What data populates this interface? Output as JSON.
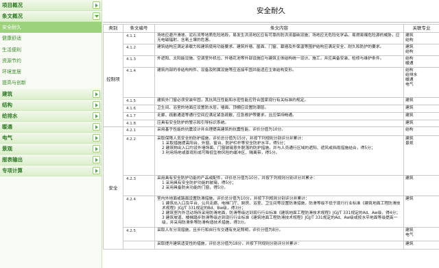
{
  "sidebar": {
    "groups_top": [
      {
        "label": "项目概况",
        "open": false
      },
      {
        "label": "条文概况",
        "open": true
      }
    ],
    "items": [
      "安全耐久",
      "健康舒适",
      "生活便利",
      "资源节约",
      "环境宜居",
      "提高与创新"
    ],
    "active_index": 0,
    "groups_bottom": [
      "建筑",
      "结构",
      "给排水",
      "暖通",
      "电气",
      "景观",
      "报表输出",
      "专项计算"
    ]
  },
  "page_title": "安全耐久",
  "table": {
    "headers": {
      "category": "类别",
      "code": "条文编号",
      "content": "条文内容",
      "prof": "关联专业"
    },
    "cat_control": "控制项",
    "cat_score": "安全",
    "control_rows": [
      {
        "code": "4.1.1",
        "content": "场地应避开滑坡、泥石流等地质危险地段，易发生洪涝地区应有可靠的防洪涝基础设施；场地应无危险化学品、易燃易爆危险源的威胁，应无电磁辐射、含氡土壤的危害。",
        "prof": [
          "建筑",
          "结构"
        ]
      },
      {
        "code": "4.1.2",
        "content": "建筑结构应满足承载力和建筑使用功能要求。建筑外墙、屋面、门窗、幕墙及外保温等围护结构应满足安全、耐久和防护的要求。",
        "prof": [
          "建筑",
          "结构"
        ]
      },
      {
        "code": "4.1.3",
        "content": "外遮阳、太阳能设施、空调室外机位、外墙花池等外部设施应与建筑主体结构统一设计、施工，并应具备安装、检修与维护条件。",
        "prof": [
          "结构",
          "暖通"
        ]
      },
      {
        "code": "4.1.4",
        "content": "建筑内部的非结构构件、设备及附属设施等应连接牢固并能适应主体结构变形。",
        "prof": [
          "结构",
          "给排水",
          "暖通",
          "电气"
        ]
      },
      {
        "code": "4.1.5",
        "content": "建筑外门窗必须安装牢固，其抗风压性能和水密性能应符合国家现行有关标准的规定。",
        "prof": [
          "建筑"
        ]
      },
      {
        "code": "4.1.6",
        "content": "卫生间、浴室的地面应设置防水层，墙面、顶棚应设置防潮层。",
        "prof": [
          "建筑"
        ]
      },
      {
        "code": "4.1.7",
        "content": "走廊、疏散通道等通行空间应满足紧急疏散、应急救护等要求，且应保持畅通。",
        "prof": [
          "建筑"
        ]
      },
      {
        "code": "4.1.8",
        "content": "应具有安全防护的警示和引导标识系统。",
        "prof": [
          "建筑"
        ]
      }
    ],
    "score_rows": [
      {
        "code": "4.2.1",
        "lines": [
          "采用基于性能的抗震设计并合理提高建筑的抗震性能。评价分值为10分。"
        ],
        "prof": [
          "结构"
        ]
      },
      {
        "code": "4.2.2",
        "lines": [
          "采取保障人员安全的防护措施，评价总分值为15分，并按下列规则分别评分并累计：",
          "1 采取措施提高阳台、外窗、窗台、防护栏杆等安全防护水平，得5分；",
          "2 建筑物出入口均设外墙饰面、门窗玻璃意外脱落的防护措施，并与人员通行区域的遮阳、遮风或挡雨措施结合，得5分；",
          "3 利用场地或景观形成可降低坠物风险的缓冲区、隔离带，得5分。"
        ],
        "prof": [
          "建筑",
          "景观"
        ]
      },
      {
        "code": "4.2.3",
        "lines": [
          "采用具有安全防护功能的产品或配件，评价总分值为10分，并按下列规则分别评分并累计：",
          "1 采用具有安全防护功能的玻璃，得5分；",
          "2 采用具备防夹功能的门窗，得5分。"
        ],
        "prof": [
          "建筑"
        ]
      },
      {
        "code": "4.2.4",
        "lines": [
          "室内外地面或路面设置防滑措施，评价总分值为10分，并按下列规则分别评分并累计：",
          "1 建筑出入口及平台、公共走廊、电梯门厅、厨房、浴室、卫生间等设置防滑措施，防滑等级不低于现行行业标准《建筑地面工程防滑技术规程》JGJ/T 331规定的Bd、Bw级，得3分；",
          "2 建筑室内外活动场所采用防滑地面，防滑等级达到现行行业标准《建筑地面工程防滑技术规程》JGJ/T 331规定的Ad、Aw级，得4分；",
          "3 建筑坡道、楼梯踏步防滑等级达到现行行业标准《建筑地面工程防滑技术规程》JGJ/T 331规定的Ad、Aw级或按水平地面等级提高一级，并采用防滑条等防滑构造技术措施，得3分。"
        ],
        "prof": [
          "建筑"
        ]
      },
      {
        "code": "4.2.5",
        "lines": [
          "采取人车分流措施，且步行和自行车交通有充足照明，评价分值为8分。"
        ],
        "prof": [
          "建筑",
          "电气"
        ]
      },
      {
        "code": "",
        "lines": [
          "采取提升建筑适变性的措施，评价总分值为18分，并按下列规则分别评分并累计："
        ],
        "prof": [
          "建筑"
        ]
      }
    ]
  }
}
